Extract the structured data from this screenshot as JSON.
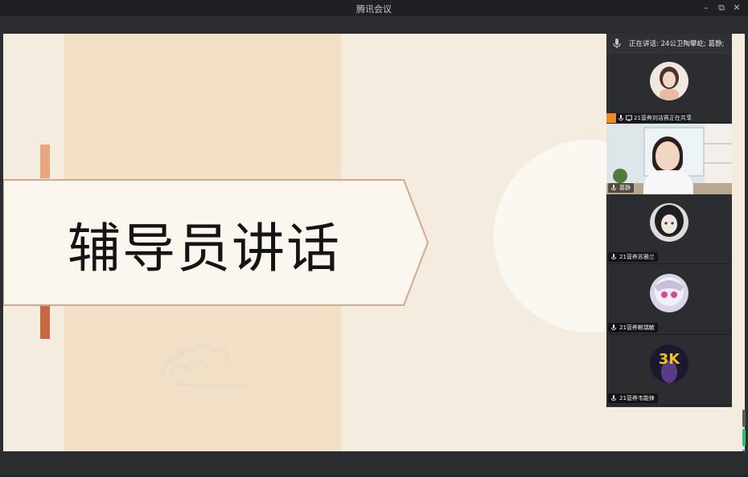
{
  "window": {
    "title": "腾讯会议",
    "minimize_glyph": "–",
    "restore_glyph": "⧉",
    "close_glyph": "✕"
  },
  "slide": {
    "title": "辅导员讲话"
  },
  "participants_panel": {
    "speaking_label": "正在讲话:  24公卫陶攀屹; 葛静;",
    "sharing_text": "21营养刘洁蓉正在共享",
    "tiles": [
      {
        "name": "",
        "kind": "avatar",
        "avatar_icon": "woman-portrait-avatar"
      },
      {
        "name": "葛静",
        "kind": "video"
      },
      {
        "name": "21营养苏雅兰",
        "kind": "avatar",
        "avatar_icon": "anime-girl-avatar"
      },
      {
        "name": "21营养赖瑞敏",
        "kind": "avatar",
        "avatar_icon": "anime-character-avatar"
      },
      {
        "name": "21营养韦能锋",
        "kind": "avatar",
        "avatar_icon": "3k-game-avatar"
      }
    ],
    "game_avatar_text": "3K"
  },
  "colors": {
    "share_badge": "#f08a24",
    "mic_active": "#27c46a",
    "accent_blue": "#2f8fe6"
  }
}
